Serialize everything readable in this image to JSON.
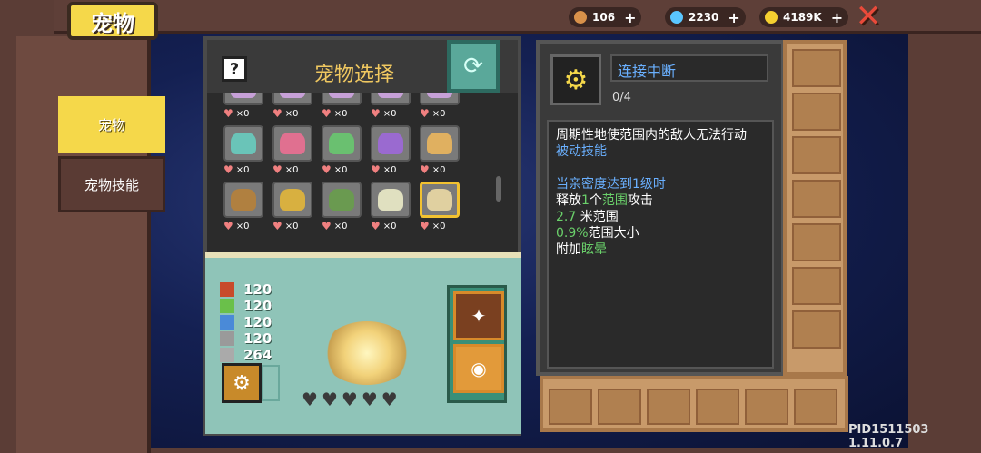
{
  "header": {
    "title": "宠物",
    "resources": [
      {
        "name": "fish",
        "value": "106",
        "color": "#d8914a"
      },
      {
        "name": "gem",
        "value": "2230",
        "color": "#5ac6ff"
      },
      {
        "name": "coin",
        "value": "4189K",
        "color": "#f5d030"
      }
    ],
    "close_icon": "close-icon"
  },
  "sidebar": {
    "tabs": [
      {
        "label": "宠物",
        "active": true
      },
      {
        "label": "宠物技能",
        "active": false
      }
    ]
  },
  "selection": {
    "title": "宠物选择",
    "help_label": "?",
    "pets": [
      {
        "count": "×0",
        "color": "#c7a0d8"
      },
      {
        "count": "×0",
        "color": "#c7a0d8"
      },
      {
        "count": "×0",
        "color": "#c7a0d8"
      },
      {
        "count": "×0",
        "color": "#c7a0d8"
      },
      {
        "count": "×0",
        "color": "#c7a0d8"
      },
      {
        "count": "×0",
        "color": "#6ac4b8"
      },
      {
        "count": "×0",
        "color": "#e07090"
      },
      {
        "count": "×0",
        "color": "#6ac070"
      },
      {
        "count": "×0",
        "color": "#9a6ad0"
      },
      {
        "count": "×0",
        "color": "#e0b060"
      },
      {
        "count": "×0",
        "color": "#b08040"
      },
      {
        "count": "×0",
        "color": "#d8b040"
      },
      {
        "count": "×0",
        "color": "#6a9a50"
      },
      {
        "count": "×0",
        "color": "#e0e0c0"
      },
      {
        "count": "×0",
        "color": "#e0d0a0"
      }
    ]
  },
  "preview": {
    "stats": [
      {
        "icon": "strength-icon",
        "value": "120"
      },
      {
        "icon": "agility-icon",
        "value": "120"
      },
      {
        "icon": "potion-icon",
        "value": "120"
      },
      {
        "icon": "tool-icon",
        "value": "120"
      },
      {
        "icon": "bag-icon",
        "value": "264"
      }
    ],
    "hearts": 5
  },
  "detail": {
    "skill_name": "连接中断",
    "progress": "0/4",
    "description": "周期性地使范围内的敌人无法行动",
    "type": "被动技能",
    "unlock": "当亲密度达到1级时",
    "line1_a": "释放",
    "line1_b": "1",
    "line1_c": "个",
    "line1_d": "范围",
    "line1_e": "攻击",
    "line2_a": "2.7",
    "line2_b": " 米范围",
    "line3_a": "0.9%",
    "line3_b": "范围大小",
    "line4_a": "附加",
    "line4_b": "眩晕"
  },
  "version": "PID1511503 1.11.0.7"
}
